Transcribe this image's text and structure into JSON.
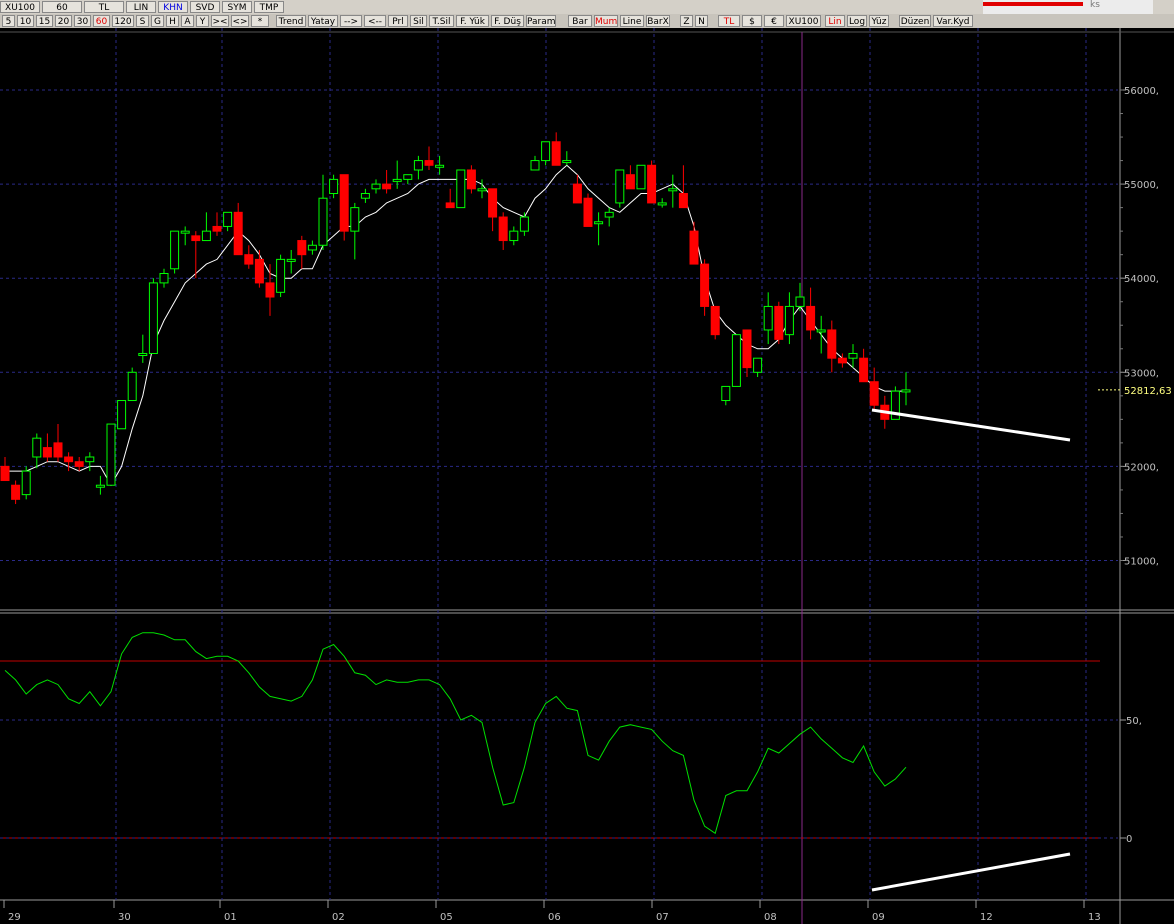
{
  "toolbar": {
    "row1": [
      {
        "label": "XU100",
        "kind": "symbol"
      },
      {
        "label": "60",
        "kind": "plain"
      },
      {
        "label": "TL",
        "kind": "plain"
      },
      {
        "label": "LIN",
        "kind": "plain"
      },
      {
        "label": "KHN",
        "kind": "blue"
      },
      {
        "label": "SVD",
        "kind": "plain"
      },
      {
        "label": "SYM",
        "kind": "plain"
      },
      {
        "label": "TMP",
        "kind": "plain"
      }
    ],
    "row2": [
      {
        "label": "5"
      },
      {
        "label": "10"
      },
      {
        "label": "15"
      },
      {
        "label": "20"
      },
      {
        "label": "30"
      },
      {
        "label": "60",
        "kind": "red"
      },
      {
        "label": "120"
      },
      {
        "label": "S"
      },
      {
        "label": "G"
      },
      {
        "label": "H"
      },
      {
        "label": "A"
      },
      {
        "label": "Y"
      },
      {
        "label": "><"
      },
      {
        "label": "<>"
      },
      {
        "label": "*"
      },
      {
        "label": "Trend"
      },
      {
        "label": "Yatay"
      },
      {
        "label": "-->"
      },
      {
        "label": "<--"
      },
      {
        "label": "Prl"
      },
      {
        "label": "Sil"
      },
      {
        "label": "T.Sil"
      },
      {
        "label": "F. Yük"
      },
      {
        "label": "F. Düş"
      },
      {
        "label": "Param"
      },
      {
        "label": "Bar"
      },
      {
        "label": "Mum",
        "kind": "red"
      },
      {
        "label": "Line"
      },
      {
        "label": "BarX"
      },
      {
        "label": "Z"
      },
      {
        "label": "N"
      },
      {
        "label": "TL",
        "kind": "red"
      },
      {
        "label": "$"
      },
      {
        "label": "€"
      },
      {
        "label": "XU100"
      },
      {
        "label": "Lin",
        "kind": "red"
      },
      {
        "label": "Log"
      },
      {
        "label": "Yüz"
      },
      {
        "label": "Düzen"
      },
      {
        "label": "Var.Kyd"
      }
    ],
    "logo_text": "ks"
  },
  "price_panel": {
    "y_ticks": [
      "56000,",
      "55000,",
      "54000,",
      "53000,",
      "52000,",
      "51000,"
    ],
    "y_values": [
      56000,
      55000,
      54000,
      53000,
      52000,
      51000
    ],
    "last_price_label": "52812,63",
    "last_price": 52812.63
  },
  "oscillator_panel": {
    "y_ticks": [
      "50,",
      "0"
    ],
    "y_values": [
      50,
      0
    ],
    "upper_line": 75,
    "lower_line": 0
  },
  "x_axis_labels": [
    "29",
    "30",
    "01",
    "02",
    "05",
    "06",
    "07",
    "08",
    "09",
    "12",
    "13"
  ],
  "colors": {
    "up_candle": "#00ff00",
    "down_candle": "#ff0000",
    "moving_average": "#ffffff",
    "oscillator": "#00e000",
    "ref_lines": "#c00000",
    "grid": "#2a2a88"
  },
  "chart_data": [
    {
      "type": "candlestick",
      "title": "",
      "series": [
        {
          "name": "",
          "x_day_labels": "29-13",
          "ohlc": [
            [
              52000,
              52100,
              51850,
              51850
            ],
            [
              51800,
              51850,
              51600,
              51650
            ],
            [
              51700,
              52000,
              51650,
              51950
            ],
            [
              52100,
              52350,
              51980,
              52300
            ],
            [
              52200,
              52350,
              52050,
              52100
            ],
            [
              52250,
              52450,
              52050,
              52100
            ],
            [
              52100,
              52150,
              51950,
              52050
            ],
            [
              52050,
              52100,
              51950,
              52000
            ],
            [
              52050,
              52150,
              51950,
              52100
            ],
            [
              51800,
              51900,
              51700,
              51800
            ],
            [
              51800,
              52450,
              51800,
              52450
            ],
            [
              52400,
              52700,
              52400,
              52700
            ],
            [
              52700,
              53050,
              52700,
              53000
            ],
            [
              53200,
              53400,
              53100,
              53200
            ],
            [
              53200,
              54000,
              53200,
              53950
            ],
            [
              53950,
              54100,
              53900,
              54050
            ],
            [
              54100,
              54500,
              54050,
              54500
            ],
            [
              54500,
              54550,
              54350,
              54500
            ],
            [
              54450,
              54500,
              54000,
              54400
            ],
            [
              54400,
              54700,
              54400,
              54500
            ],
            [
              54550,
              54700,
              54450,
              54500
            ],
            [
              54550,
              54700,
              54500,
              54700
            ],
            [
              54700,
              54800,
              54500,
              54250
            ],
            [
              54250,
              54350,
              54100,
              54150
            ],
            [
              54200,
              54300,
              53900,
              53950
            ],
            [
              53950,
              54150,
              53600,
              53800
            ],
            [
              53850,
              54250,
              53800,
              54200
            ],
            [
              54200,
              54300,
              54050,
              54200
            ],
            [
              54400,
              54450,
              54100,
              54250
            ],
            [
              54300,
              54400,
              54250,
              54350
            ],
            [
              54350,
              55100,
              54300,
              54850
            ],
            [
              54900,
              55100,
              54850,
              55050
            ],
            [
              55100,
              55100,
              54400,
              54500
            ],
            [
              54500,
              54800,
              54200,
              54750
            ],
            [
              54850,
              54950,
              54800,
              54900
            ],
            [
              54950,
              55050,
              54900,
              55000
            ],
            [
              55000,
              55150,
              54900,
              54950
            ],
            [
              55050,
              55250,
              54950,
              55050
            ],
            [
              55050,
              55100,
              55000,
              55100
            ],
            [
              55150,
              55300,
              55050,
              55250
            ],
            [
              55250,
              55400,
              55150,
              55200
            ],
            [
              55200,
              55300,
              55100,
              55200
            ],
            [
              54800,
              54950,
              54750,
              54750
            ],
            [
              54750,
              55150,
              54750,
              55150
            ],
            [
              55150,
              55200,
              54900,
              54950
            ],
            [
              54950,
              55050,
              54850,
              54950
            ],
            [
              54950,
              54950,
              54500,
              54650
            ],
            [
              54650,
              54700,
              54300,
              54400
            ],
            [
              54400,
              54550,
              54350,
              54500
            ],
            [
              54500,
              54700,
              54450,
              54650
            ],
            [
              55150,
              55300,
              55150,
              55250
            ],
            [
              55250,
              55450,
              55200,
              55450
            ],
            [
              55450,
              55550,
              55200,
              55200
            ],
            [
              55250,
              55350,
              55200,
              55250
            ],
            [
              55000,
              55100,
              54900,
              54800
            ],
            [
              54850,
              54900,
              54550,
              54550
            ],
            [
              54600,
              54700,
              54350,
              54600
            ],
            [
              54650,
              54750,
              54550,
              54700
            ],
            [
              54800,
              55150,
              54750,
              55150
            ],
            [
              55100,
              55200,
              54950,
              54950
            ],
            [
              54950,
              55200,
              54950,
              55200
            ],
            [
              55200,
              55250,
              54800,
              54800
            ],
            [
              54800,
              54850,
              54750,
              54800
            ],
            [
              54950,
              55100,
              54750,
              54950
            ],
            [
              54900,
              55200,
              54750,
              54750
            ],
            [
              54500,
              54600,
              54200,
              54150
            ],
            [
              54150,
              54200,
              53600,
              53700
            ],
            [
              53700,
              53700,
              53350,
              53400
            ],
            [
              52700,
              52800,
              52650,
              52850
            ],
            [
              52850,
              53400,
              52850,
              53400
            ],
            [
              53450,
              53450,
              52950,
              53050
            ],
            [
              53000,
              53150,
              52950,
              53150
            ],
            [
              53450,
              53850,
              53300,
              53700
            ],
            [
              53700,
              53750,
              53300,
              53350
            ],
            [
              53400,
              53850,
              53300,
              53700
            ],
            [
              53700,
              53950,
              53650,
              53800
            ],
            [
              53700,
              53900,
              53350,
              53450
            ],
            [
              53450,
              53600,
              53200,
              53450
            ],
            [
              53450,
              53550,
              53000,
              53150
            ],
            [
              53150,
              53200,
              53050,
              53100
            ],
            [
              53150,
              53300,
              53050,
              53200
            ],
            [
              53150,
              53250,
              52900,
              52900
            ],
            [
              52900,
              53050,
              52600,
              52650
            ],
            [
              52650,
              52750,
              52400,
              52500
            ],
            [
              52500,
              52850,
              52500,
              52800
            ],
            [
              52800,
              53000,
              52650,
              52812.63
            ]
          ]
        },
        {
          "name": "",
          "ma": [
            51950,
            51950,
            51950,
            52000,
            52050,
            52050,
            52000,
            51950,
            52000,
            52000,
            51800,
            52000,
            52400,
            52750,
            53300,
            53550,
            53750,
            53950,
            54050,
            54150,
            54200,
            54350,
            54500,
            54400,
            54250,
            54050,
            54000,
            54000,
            54100,
            54100,
            54350,
            54450,
            54550,
            54550,
            54650,
            54700,
            54800,
            54850,
            54900,
            55000,
            55050,
            55050,
            55050,
            55050,
            55050,
            55000,
            54850,
            54750,
            54700,
            54650,
            54850,
            54950,
            55100,
            55200,
            55100,
            54950,
            54850,
            54750,
            54700,
            54800,
            54900,
            54900,
            54950,
            55000,
            54900,
            54550,
            54000,
            53650,
            53500,
            53400,
            53300,
            53250,
            53250,
            53350,
            53550,
            53700,
            53550,
            53400,
            53250,
            53150,
            53050,
            52950,
            52850,
            52800,
            52800,
            52800
          ]
        }
      ]
    },
    {
      "type": "line",
      "title": "",
      "series": [
        {
          "name": "",
          "values": [
            71,
            67,
            61,
            65,
            67,
            65,
            59,
            57,
            62,
            56,
            62,
            78,
            85,
            87,
            87,
            86,
            84,
            84,
            79,
            76,
            77,
            77,
            75,
            70,
            64,
            60,
            59,
            58,
            60,
            67,
            80,
            82,
            77,
            70,
            69,
            65,
            67,
            66,
            66,
            67,
            67,
            65,
            59,
            50,
            52,
            49,
            30,
            14,
            15,
            30,
            49,
            57,
            60,
            55,
            54,
            35,
            33,
            41,
            47,
            48,
            47,
            46,
            41,
            37,
            35,
            16,
            5,
            2,
            18,
            20,
            20,
            28,
            38,
            36,
            40,
            44,
            47,
            42,
            38,
            34,
            32,
            39,
            28,
            22,
            25,
            30
          ]
        }
      ],
      "ylim": [
        -5,
        97
      ]
    }
  ]
}
